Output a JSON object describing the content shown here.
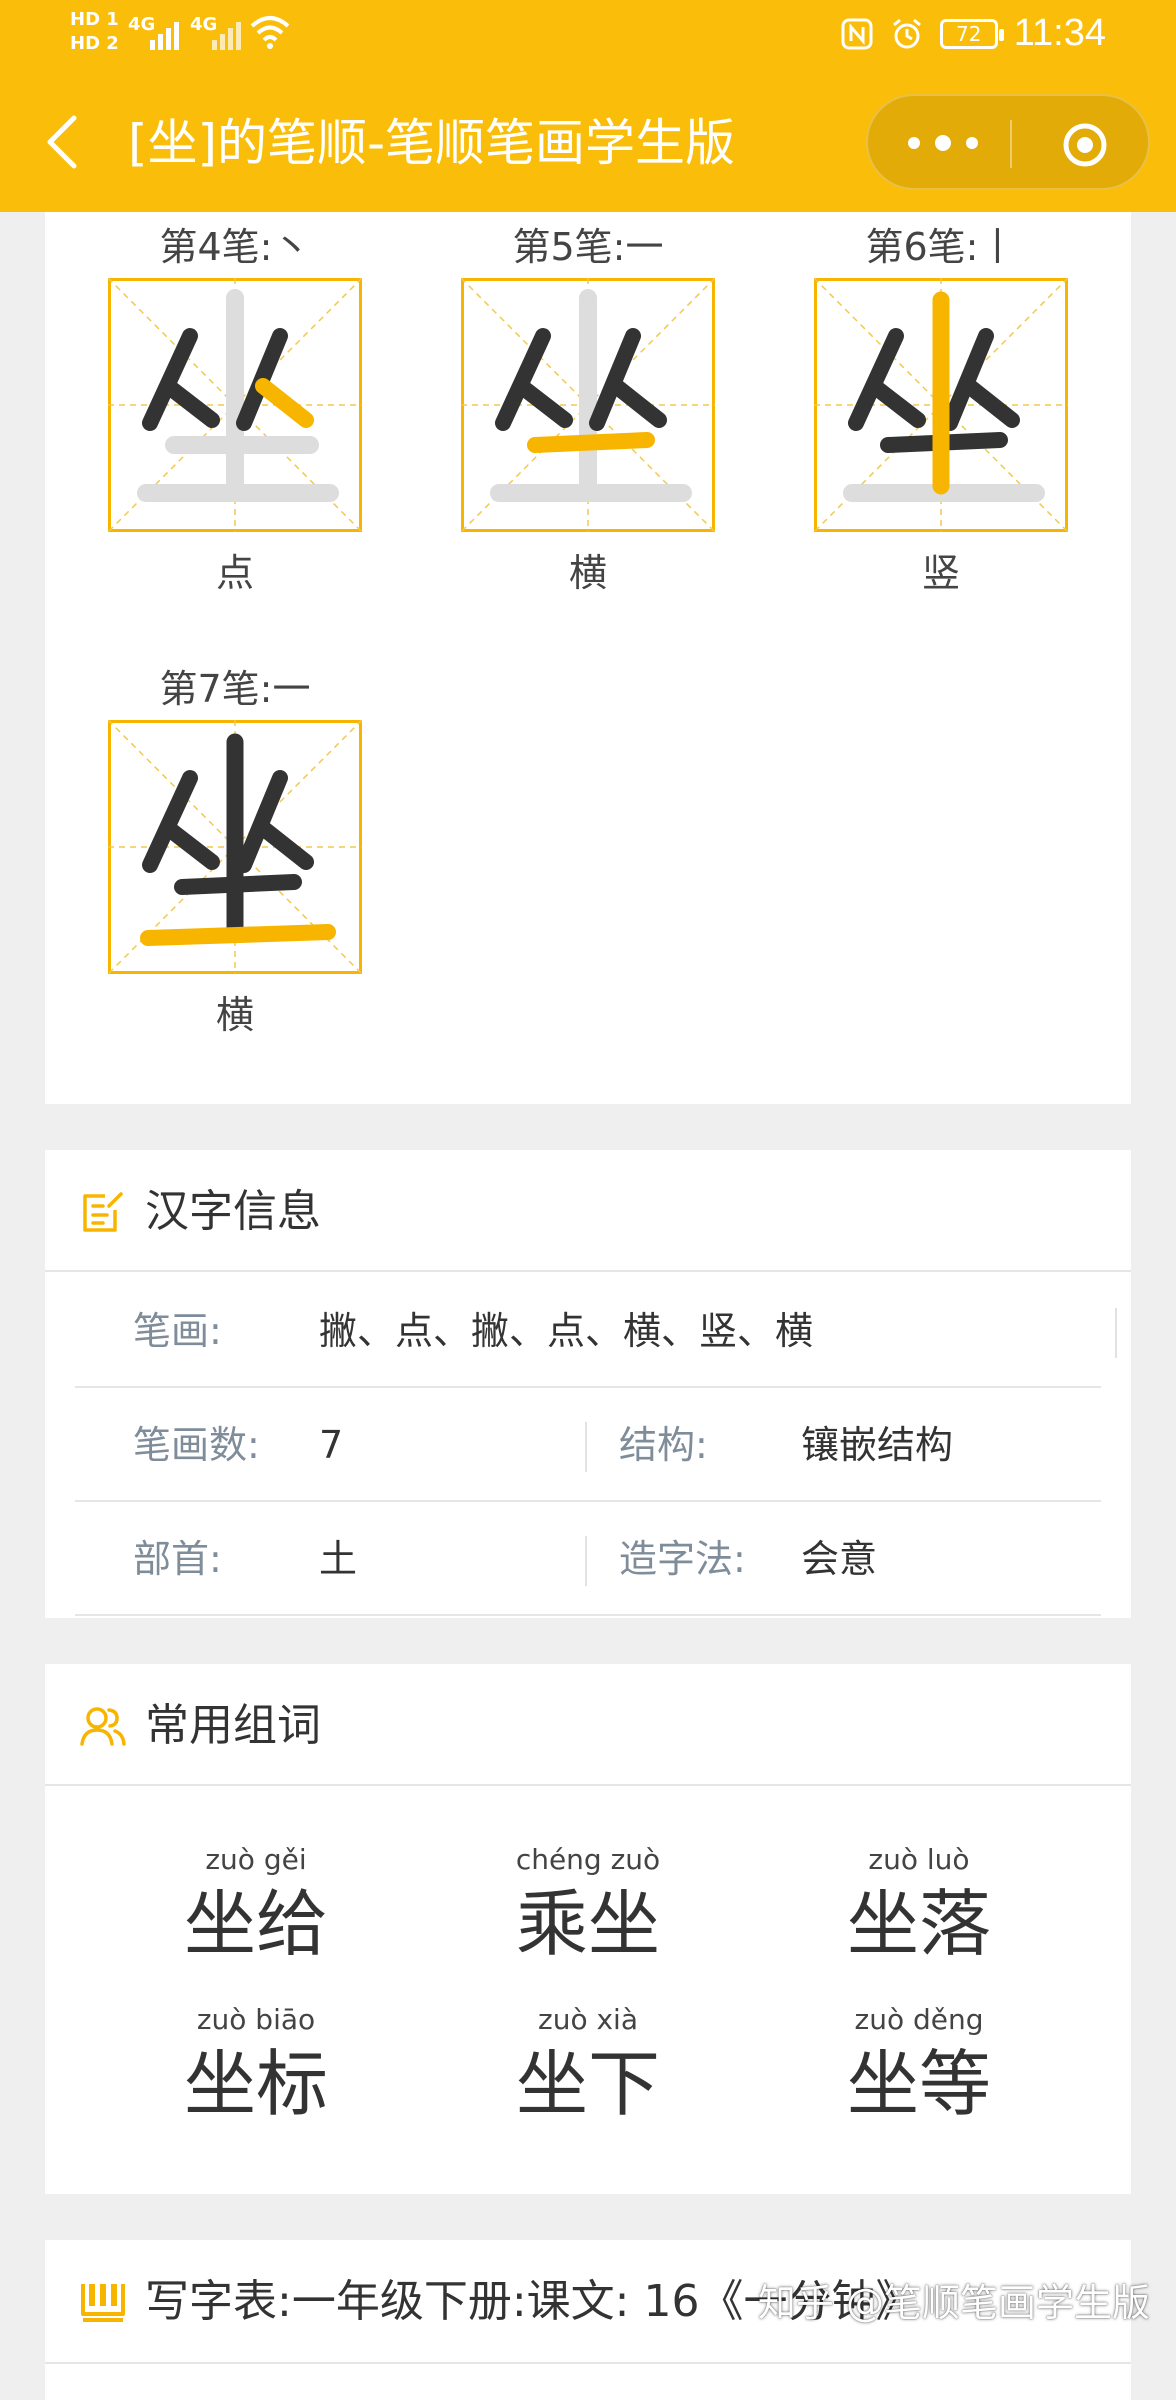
{
  "status_bar": {
    "hd1": "HD 1",
    "hd2": "HD 2",
    "net1": "4G",
    "net2": "4G",
    "battery": "72",
    "time": "11:34"
  },
  "nav": {
    "title": "[坐]的笔顺-笔顺笔画学生版"
  },
  "strokes": [
    {
      "label": "第4笔:丶",
      "name": "点"
    },
    {
      "label": "第5笔:一",
      "name": "横"
    },
    {
      "label": "第6笔:丨",
      "name": "竖"
    },
    {
      "label": "第7笔:一",
      "name": "横"
    }
  ],
  "char_info": {
    "title": "汉字信息",
    "stroke_key": "笔画:",
    "stroke_val": "撇、点、撇、点、横、竖、横",
    "count_key": "笔画数:",
    "count_val": "7",
    "struct_key": "结构:",
    "struct_val": "镶嵌结构",
    "radical_key": "部首:",
    "radical_val": "土",
    "method_key": "造字法:",
    "method_val": "会意"
  },
  "words": {
    "title": "常用组词",
    "items": [
      {
        "pinyin": "zuò gěi",
        "word": "坐给"
      },
      {
        "pinyin": "chéng zuò",
        "word": "乘坐"
      },
      {
        "pinyin": "zuò luò",
        "word": "坐落"
      },
      {
        "pinyin": "zuò biāo",
        "word": "坐标"
      },
      {
        "pinyin": "zuò xià",
        "word": "坐下"
      },
      {
        "pinyin": "zuò děng",
        "word": "坐等"
      }
    ]
  },
  "writing_table": {
    "title": "写字表:一年级下册:课文:  16《一分钟》"
  },
  "watermark": "知乎 @笔顺笔画学生版",
  "colors": {
    "accent": "#f9bd0a",
    "highlight_stroke": "#f7b500",
    "ghost_stroke": "#dddddd",
    "done_stroke": "#333333",
    "label_gray": "#7f8c99"
  }
}
